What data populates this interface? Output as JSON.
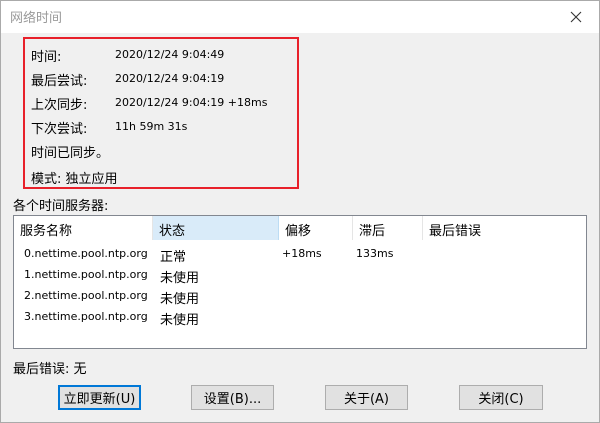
{
  "window": {
    "title": "网络时间"
  },
  "status": {
    "rows": [
      {
        "label": "时间:",
        "value": "2020/12/24 9:04:49"
      },
      {
        "label": "最后尝试:",
        "value": "2020/12/24 9:04:19"
      },
      {
        "label": "上次同步:",
        "value": "2020/12/24 9:04:19 +18ms"
      },
      {
        "label": "下次尝试:",
        "value": "11h 59m 31s"
      }
    ],
    "synced_message": "时间已同步。",
    "mode": "模式: 独立应用"
  },
  "servers": {
    "section_label": "各个时间服务器:",
    "columns": [
      "服务名称",
      "状态",
      "偏移",
      "滞后",
      "最后错误"
    ],
    "rows": [
      {
        "name": "0.nettime.pool.ntp.org",
        "status": "正常",
        "offset": "+18ms",
        "lag": "133ms",
        "error": ""
      },
      {
        "name": "1.nettime.pool.ntp.org",
        "status": "未使用",
        "offset": "",
        "lag": "",
        "error": ""
      },
      {
        "name": "2.nettime.pool.ntp.org",
        "status": "未使用",
        "offset": "",
        "lag": "",
        "error": ""
      },
      {
        "name": "3.nettime.pool.ntp.org",
        "status": "未使用",
        "offset": "",
        "lag": "",
        "error": ""
      }
    ]
  },
  "last_error": "最后错误: 无",
  "buttons": {
    "update_now": "立即更新(U)",
    "settings": "设置(B)...",
    "about": "关于(A)",
    "close": "关闭(C)"
  },
  "colors": {
    "highlight_border": "#e8202a",
    "default_button_border": "#0078d7",
    "sorted_column": "#d9ebf9"
  }
}
